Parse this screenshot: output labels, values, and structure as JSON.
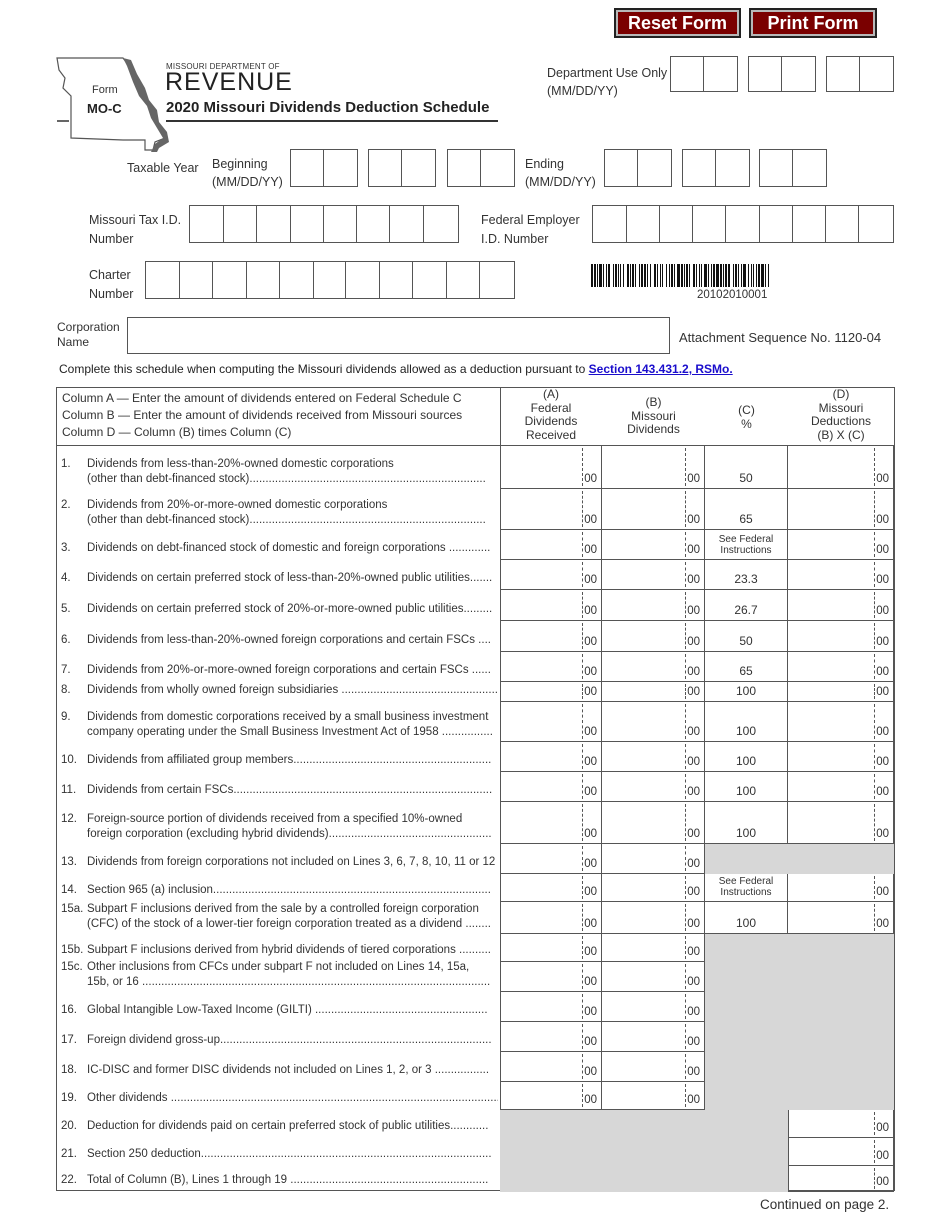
{
  "buttons": {
    "reset": "Reset Form",
    "print": "Print Form"
  },
  "header": {
    "form_label": "Form",
    "form_id": "MO-C",
    "dept_small": "MISSOURI DEPARTMENT OF",
    "dept_big": "REVENUE",
    "title": "2020 Missouri Dividends Deduction Schedule",
    "dept_use_label": "Department Use Only",
    "dept_use_format": "(MM/DD/YY)"
  },
  "fields": {
    "taxable_year": "Taxable Year",
    "beginning": "Beginning",
    "ending": "Ending",
    "date_format": "(MM/DD/YY)",
    "mo_tax_id_1": "Missouri Tax I.D.",
    "mo_tax_id_2": "Number",
    "fein_1": "Federal Employer",
    "fein_2": "I.D. Number",
    "charter_1": "Charter",
    "charter_2": "Number",
    "corp_1": "Corporation",
    "corp_2": "Name",
    "corp_value": "",
    "barcode_number": "20102010001",
    "attachment": "Attachment Sequence No. 1120-04"
  },
  "instruction": {
    "text": "Complete this schedule when computing the Missouri dividends allowed as a deduction pursuant to ",
    "link": "Section 143.431.2, RSMo."
  },
  "table": {
    "header_notes": [
      "Column A — Enter the amount of dividends entered on Federal Schedule C",
      "Column B — Enter the amount of dividends received from Missouri sources",
      "Column D — Column (B) times Column (C)"
    ],
    "col_a": [
      "(A)",
      "Federal",
      "Dividends",
      "Received"
    ],
    "col_b": [
      "(B)",
      "Missouri",
      "Dividends"
    ],
    "col_c": [
      "(C)",
      "%"
    ],
    "col_d": [
      "(D)",
      "Missouri",
      "Deductions",
      "(B) X (C)"
    ],
    "cents": "00",
    "rows": [
      {
        "num": "1.",
        "l1": "Dividends from less-than-20%-owned domestic corporations",
        "l2": "(other than debt-financed stock)..........................................................................",
        "pct": "50"
      },
      {
        "num": "2.",
        "l1": "Dividends from 20%-or-more-owned domestic corporations",
        "l2": "(other than debt-financed stock)..........................................................................",
        "pct": "65"
      },
      {
        "num": "3.",
        "l1": "Dividends on debt-financed stock of domestic and foreign corporations .............",
        "l2": "",
        "pct": "See Federal Instructions"
      },
      {
        "num": "4.",
        "l1": "Dividends on certain preferred stock of less-than-20%-owned public utilities.......",
        "l2": "",
        "pct": "23.3"
      },
      {
        "num": "5.",
        "l1": "Dividends on certain preferred stock of 20%-or-more-owned public utilities.........",
        "l2": "",
        "pct": "26.7"
      },
      {
        "num": "6.",
        "l1": "Dividends from less-than-20%-owned foreign corporations and certain FSCs ....",
        "l2": "",
        "pct": "50"
      },
      {
        "num": "7.",
        "l1": "Dividends from 20%-or-more-owned foreign corporations and certain FSCs ......",
        "l2": "",
        "pct": "65"
      },
      {
        "num": "8.",
        "l1": "Dividends from wholly owned foreign subsidiaries .................................................",
        "l2": "",
        "pct": "100"
      },
      {
        "num": "9.",
        "l1": "Dividends from domestic corporations received by a small business investment",
        "l2": "company operating under the Small Business Investment Act of 1958 ................",
        "pct": "100"
      },
      {
        "num": "10.",
        "l1": "Dividends from affiliated group members..............................................................",
        "l2": "",
        "pct": "100"
      },
      {
        "num": "11.",
        "l1": "Dividends from certain FSCs.................................................................................",
        "l2": "",
        "pct": "100"
      },
      {
        "num": "12.",
        "l1": "Foreign-source portion of dividends received from a specified 10%-owned",
        "l2": "foreign corporation (excluding hybrid dividends)...................................................",
        "pct": "100"
      },
      {
        "num": "13.",
        "l1": "Dividends from foreign corporations not included on Lines 3, 6, 7, 8, 10, 11 or 12 .",
        "l2": "",
        "pct": ""
      },
      {
        "num": "14.",
        "l1": "Section 965 (a) inclusion.......................................................................................",
        "l2": "",
        "pct": "See Federal Instructions"
      },
      {
        "num": "15a.",
        "l1": "Subpart F inclusions derived from the sale by a controlled foreign corporation",
        "l2": "(CFC) of the stock of a lower-tier foreign corporation treated as a dividend ........",
        "pct": "100"
      },
      {
        "num": "15b.",
        "l1": "Subpart F inclusions derived from hybrid dividends of tiered corporations ..........",
        "l2": "",
        "pct": ""
      },
      {
        "num": "15c.",
        "l1": "Other inclusions from CFCs under subpart F not included on Lines 14, 15a,",
        "l2": "15b, or 16 .............................................................................................................",
        "pct": ""
      },
      {
        "num": "16.",
        "l1": "Global Intangible Low-Taxed Income (GILTI) ......................................................",
        "l2": "",
        "pct": ""
      },
      {
        "num": "17.",
        "l1": "Foreign dividend gross-up.....................................................................................",
        "l2": "",
        "pct": ""
      },
      {
        "num": "18.",
        "l1": "IC-DISC and former DISC dividends not included on Lines 1, 2, or 3 .................",
        "l2": "",
        "pct": ""
      },
      {
        "num": "19.",
        "l1": "Other dividends .......................................................................................................",
        "l2": "",
        "pct": ""
      },
      {
        "num": "20.",
        "l1": "Deduction for dividends paid on certain preferred stock of public utilities............",
        "l2": "",
        "pct": ""
      },
      {
        "num": "21.",
        "l1": "Section 250 deduction...........................................................................................",
        "l2": "",
        "pct": ""
      },
      {
        "num": "22.",
        "l1": "Total of Column (B), Lines 1 through 19 ..............................................................",
        "l2": "",
        "pct": ""
      }
    ]
  },
  "footer": {
    "continued": "Continued on page 2."
  },
  "colors": {
    "button_bg": "#7a0000",
    "link": "#1a0dcc",
    "shade": "#d7d7d7"
  }
}
